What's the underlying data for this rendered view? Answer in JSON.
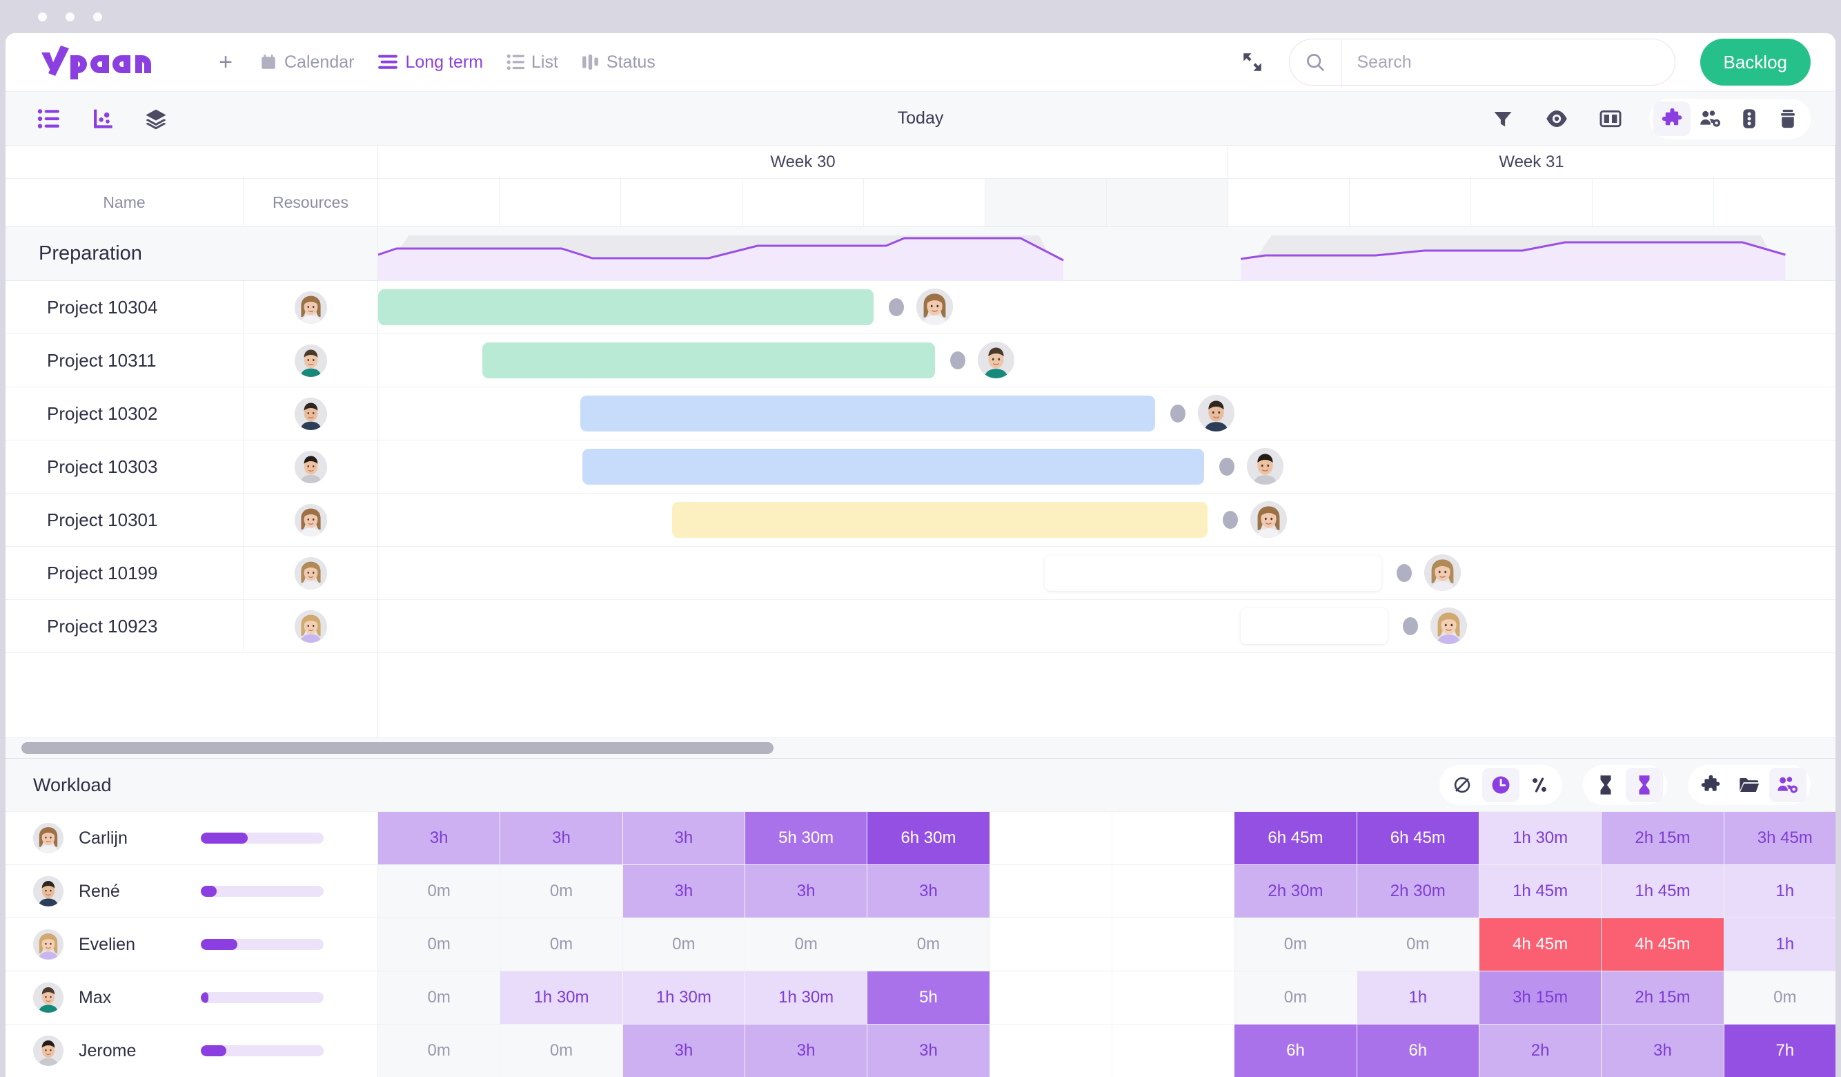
{
  "window": {
    "dots": [
      "close",
      "minimize",
      "zoom"
    ]
  },
  "brand": {
    "name": "vplan",
    "color": "#8b3fe0"
  },
  "topnav": {
    "add_label": "+",
    "tabs": [
      {
        "label": "Calendar",
        "icon": "calendar-icon",
        "active": false
      },
      {
        "label": "Long term",
        "icon": "long-term-icon",
        "active": true
      },
      {
        "label": "List",
        "icon": "list-icon",
        "active": false
      },
      {
        "label": "Status",
        "icon": "status-icon",
        "active": false
      }
    ],
    "expand_icon": "expand-icon",
    "search": {
      "placeholder": "Search",
      "value": "",
      "icon": "search-icon"
    },
    "backlog_label": "Backlog",
    "backlog_color": "#26c08a"
  },
  "toolbar": {
    "left_icons": [
      "list-view-icon",
      "chart-view-icon",
      "layers-view-icon"
    ],
    "today_label": "Today",
    "right_icons": [
      "filter-icon",
      "eye-icon",
      "columns-icon"
    ],
    "right_pill": [
      "puzzle-icon",
      "team-settings-icon",
      "traffic-light-icon",
      "archive-icon"
    ]
  },
  "gantt": {
    "columns": {
      "name": "Name",
      "resources": "Resources"
    },
    "weeks": [
      {
        "label": "Week 30"
      },
      {
        "label": "Week 31"
      }
    ],
    "group": {
      "label": "Preparation"
    },
    "rows": [
      {
        "name": "Project 10304",
        "bar_color": "#b8ead6",
        "start": 0.0,
        "end": 4.05,
        "avatar": "avatar-carlijn"
      },
      {
        "name": "Project 10311",
        "bar_color": "#b8ead6",
        "start": 0.85,
        "end": 4.55,
        "avatar": "avatar-max"
      },
      {
        "name": "Project 10302",
        "bar_color": "#c7dcfb",
        "start": 1.65,
        "end": 6.35,
        "avatar": "avatar-rene"
      },
      {
        "name": "Project 10303",
        "bar_color": "#c7dcfb",
        "start": 1.67,
        "end": 6.75,
        "avatar": "avatar-jerome"
      },
      {
        "name": "Project 10301",
        "bar_color": "#fdf0c0",
        "start": 2.4,
        "end": 6.78,
        "avatar": "avatar-carlijn"
      },
      {
        "name": "Project 10199",
        "bar_color": "#ffffff",
        "start": 5.45,
        "end": 8.2,
        "avatar": "avatar-evelien"
      },
      {
        "name": "Project 10923",
        "bar_color": "#ffffff",
        "start": 7.05,
        "end": 8.25,
        "avatar": "avatar-evelien2"
      }
    ],
    "capacity_note": "capacity area chart over group row"
  },
  "scrollbar": {
    "thumb_start_pct": 0.4,
    "thumb_width_pct": 41.5
  },
  "workload": {
    "title": "Workload",
    "tool_groups": [
      {
        "icons": [
          "no-value-icon",
          "clock-icon",
          "percent-icon"
        ],
        "active": 1
      },
      {
        "icons": [
          "hourglass-start-icon",
          "hourglass-end-icon"
        ],
        "active": 1
      },
      {
        "icons": [
          "puzzle-icon",
          "folder-icon",
          "team-settings-icon"
        ],
        "active": 2
      }
    ],
    "people": [
      {
        "name": "Carlijn",
        "avatar": "avatar-carlijn",
        "progress": 38,
        "cells": [
          {
            "v": "3h",
            "lvl": 2
          },
          {
            "v": "3h",
            "lvl": 2
          },
          {
            "v": "3h",
            "lvl": 2
          },
          {
            "v": "5h 30m",
            "lvl": 4
          },
          {
            "v": "6h 30m",
            "lvl": 5
          },
          {
            "v": "",
            "lvl": -1
          },
          {
            "v": "",
            "lvl": -1
          },
          {
            "v": "6h 45m",
            "lvl": 5
          },
          {
            "v": "6h 45m",
            "lvl": 5
          },
          {
            "v": "1h 30m",
            "lvl": 1
          },
          {
            "v": "2h 15m",
            "lvl": 2
          },
          {
            "v": "3h 45m",
            "lvl": 2
          }
        ]
      },
      {
        "name": "René",
        "avatar": "avatar-rene",
        "progress": 13,
        "cells": [
          {
            "v": "0m",
            "lvl": 0
          },
          {
            "v": "0m",
            "lvl": 0
          },
          {
            "v": "3h",
            "lvl": 2
          },
          {
            "v": "3h",
            "lvl": 2
          },
          {
            "v": "3h",
            "lvl": 2
          },
          {
            "v": "",
            "lvl": -1
          },
          {
            "v": "",
            "lvl": -1
          },
          {
            "v": "2h 30m",
            "lvl": 2
          },
          {
            "v": "2h 30m",
            "lvl": 2
          },
          {
            "v": "1h 45m",
            "lvl": 1
          },
          {
            "v": "1h 45m",
            "lvl": 1
          },
          {
            "v": "1h",
            "lvl": 1
          }
        ]
      },
      {
        "name": "Evelien",
        "avatar": "avatar-evelien2",
        "progress": 30,
        "cells": [
          {
            "v": "0m",
            "lvl": 0
          },
          {
            "v": "0m",
            "lvl": 0
          },
          {
            "v": "0m",
            "lvl": 0
          },
          {
            "v": "0m",
            "lvl": 0
          },
          {
            "v": "0m",
            "lvl": 0
          },
          {
            "v": "",
            "lvl": -1
          },
          {
            "v": "",
            "lvl": -1
          },
          {
            "v": "0m",
            "lvl": 0
          },
          {
            "v": "0m",
            "lvl": 0
          },
          {
            "v": "4h 45m",
            "lvl": 9
          },
          {
            "v": "4h 45m",
            "lvl": 9
          },
          {
            "v": "1h",
            "lvl": 1
          }
        ]
      },
      {
        "name": "Max",
        "avatar": "avatar-max",
        "progress": 6,
        "cells": [
          {
            "v": "0m",
            "lvl": 0
          },
          {
            "v": "1h 30m",
            "lvl": 1
          },
          {
            "v": "1h 30m",
            "lvl": 1
          },
          {
            "v": "1h 30m",
            "lvl": 1
          },
          {
            "v": "5h",
            "lvl": 4
          },
          {
            "v": "",
            "lvl": -1
          },
          {
            "v": "",
            "lvl": -1
          },
          {
            "v": "0m",
            "lvl": 0
          },
          {
            "v": "1h",
            "lvl": 1
          },
          {
            "v": "3h 15m",
            "lvl": 3
          },
          {
            "v": "2h 15m",
            "lvl": 2
          },
          {
            "v": "0m",
            "lvl": 0
          }
        ]
      },
      {
        "name": "Jerome",
        "avatar": "avatar-jerome",
        "progress": 21,
        "cells": [
          {
            "v": "0m",
            "lvl": 0
          },
          {
            "v": "0m",
            "lvl": 0
          },
          {
            "v": "3h",
            "lvl": 2
          },
          {
            "v": "3h",
            "lvl": 2
          },
          {
            "v": "3h",
            "lvl": 2
          },
          {
            "v": "",
            "lvl": -1
          },
          {
            "v": "",
            "lvl": -1
          },
          {
            "v": "6h",
            "lvl": 4
          },
          {
            "v": "6h",
            "lvl": 4
          },
          {
            "v": "2h",
            "lvl": 2
          },
          {
            "v": "3h",
            "lvl": 2
          },
          {
            "v": "7h",
            "lvl": 5
          }
        ]
      }
    ],
    "level_colors": {
      "0": "#f7f8fa",
      "1": "#e8dcfa",
      "2": "#cdb0f2",
      "3": "#bb93ee",
      "4": "#a972ea",
      "5": "#9450e3",
      "9": "#fb5f72"
    }
  }
}
